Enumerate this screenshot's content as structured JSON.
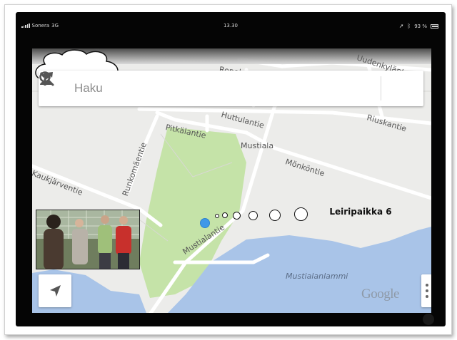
{
  "status_bar": {
    "carrier": "Sonera",
    "network": "3G",
    "time": "13.30",
    "battery": "93 %"
  },
  "search": {
    "placeholder": "Haku"
  },
  "map": {
    "labels": {
      "uusienkylantie": "Uudenkylänt",
      "repola": "Repol",
      "huttulantie": "Huttulantie",
      "riuskantie": "Riuskantie",
      "pitkalantie": "Pitkälantie",
      "mustiala": "Mustiala",
      "runkomaentie": "Runkomäentie",
      "monkontie": "Mönköntie",
      "kaukjarventie": "Kaukjärventie",
      "mustialantie": "Mustialantie",
      "mustialanlammi": "Mustialanlammi"
    },
    "callout": "Leiripaikka 6",
    "logo": "Google"
  },
  "colors": {
    "map_land": "#ececea",
    "park": "#c5e3a8",
    "water": "#a9c4e8",
    "location": "#3f98e8"
  }
}
